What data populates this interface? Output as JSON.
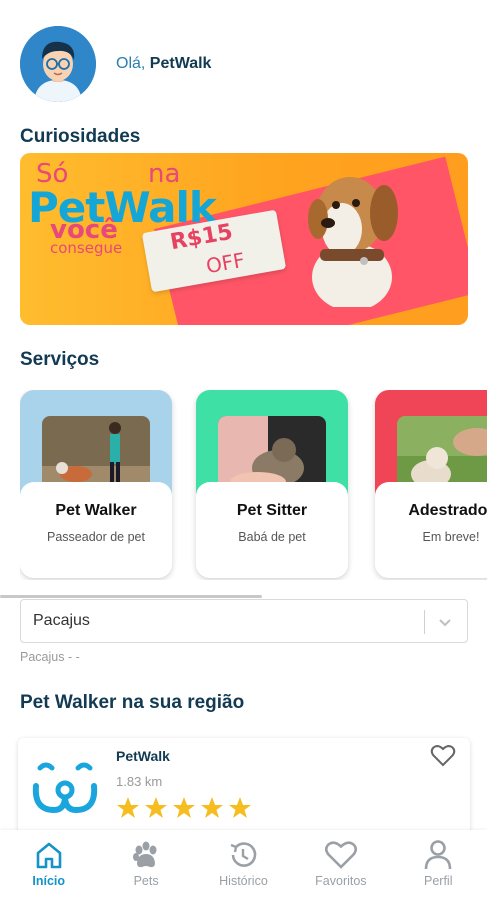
{
  "header": {
    "greeting": "Olá,",
    "user_name": "PetWalk"
  },
  "curiosidades": {
    "title": "Curiosidades",
    "banner": {
      "line1a": "Só",
      "line1b": "na",
      "brand": "PetWalk",
      "line3": "você",
      "line4": "consegue",
      "price": "R$15",
      "off": "OFF"
    }
  },
  "servicos": {
    "title": "Serviços",
    "items": [
      {
        "title": "Pet Walker",
        "subtitle": "Passeador de pet",
        "color": "#a9d3ea"
      },
      {
        "title": "Pet Sitter",
        "subtitle": "Babá de pet",
        "color": "#3ee0a5"
      },
      {
        "title": "Adestrador",
        "subtitle": "Em breve!",
        "color": "#f04556"
      }
    ]
  },
  "location": {
    "selected": "Pacajus",
    "helper": "Pacajus - -"
  },
  "regiao": {
    "title": "Pet Walker na sua região",
    "walker": {
      "name": "PetWalk",
      "distance": "1.83 km",
      "rating": 5
    }
  },
  "nav": {
    "items": [
      {
        "label": "Início",
        "icon": "home-icon",
        "active": true
      },
      {
        "label": "Pets",
        "icon": "paw-icon",
        "active": false
      },
      {
        "label": "Histórico",
        "icon": "history-icon",
        "active": false
      },
      {
        "label": "Favoritos",
        "icon": "heart-icon",
        "active": false
      },
      {
        "label": "Perfil",
        "icon": "user-icon",
        "active": false
      }
    ]
  },
  "colors": {
    "primary": "#123a52",
    "accent": "#1593c8",
    "star": "#f5bd1f"
  }
}
